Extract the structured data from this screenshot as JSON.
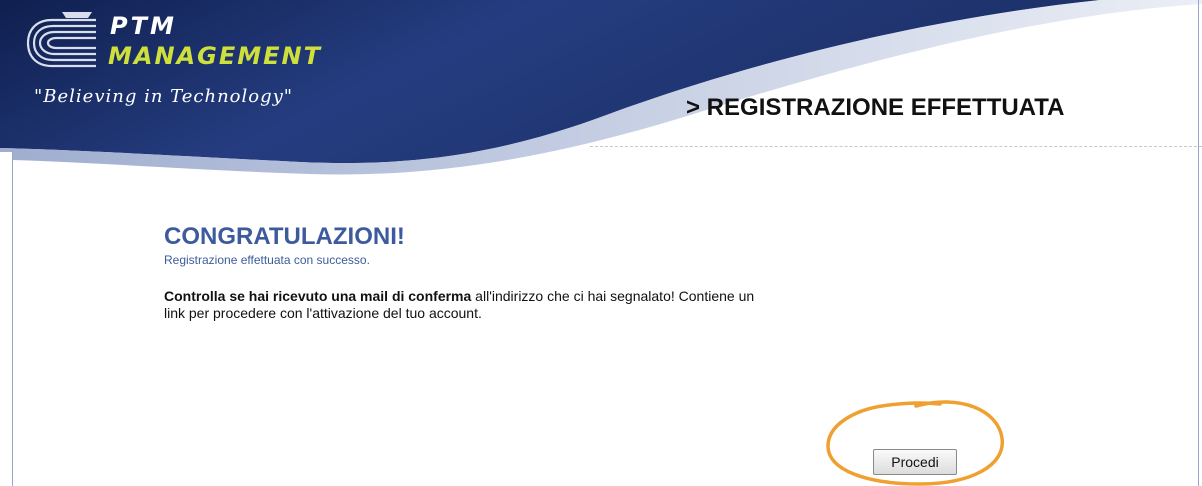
{
  "brand": {
    "line1": "PTM",
    "line2": "MANAGEMENT",
    "tagline": "\"Believing in Technology\""
  },
  "page": {
    "heading": "> REGISTRAZIONE EFFETTUATA"
  },
  "message": {
    "title": "CONGRATULAZIONI!",
    "subtitle": "Registrazione effettuata con successo.",
    "instruction_bold": "Controlla se hai ricevuto una mail di conferma",
    "instruction_rest": " all'indirizzo che ci hai segnalato! Contiene un link per procedere con l'attivazione del tuo account."
  },
  "actions": {
    "proceed_label": "Procedi"
  },
  "colors": {
    "header_dark": "#1c2f66",
    "header_light": "#dfe4f0",
    "title_blue": "#3d5b9c",
    "brand_accent": "#cfe03a",
    "annotation_orange": "#f0a030"
  },
  "icons": {
    "logo": "ptm-logo-icon"
  }
}
